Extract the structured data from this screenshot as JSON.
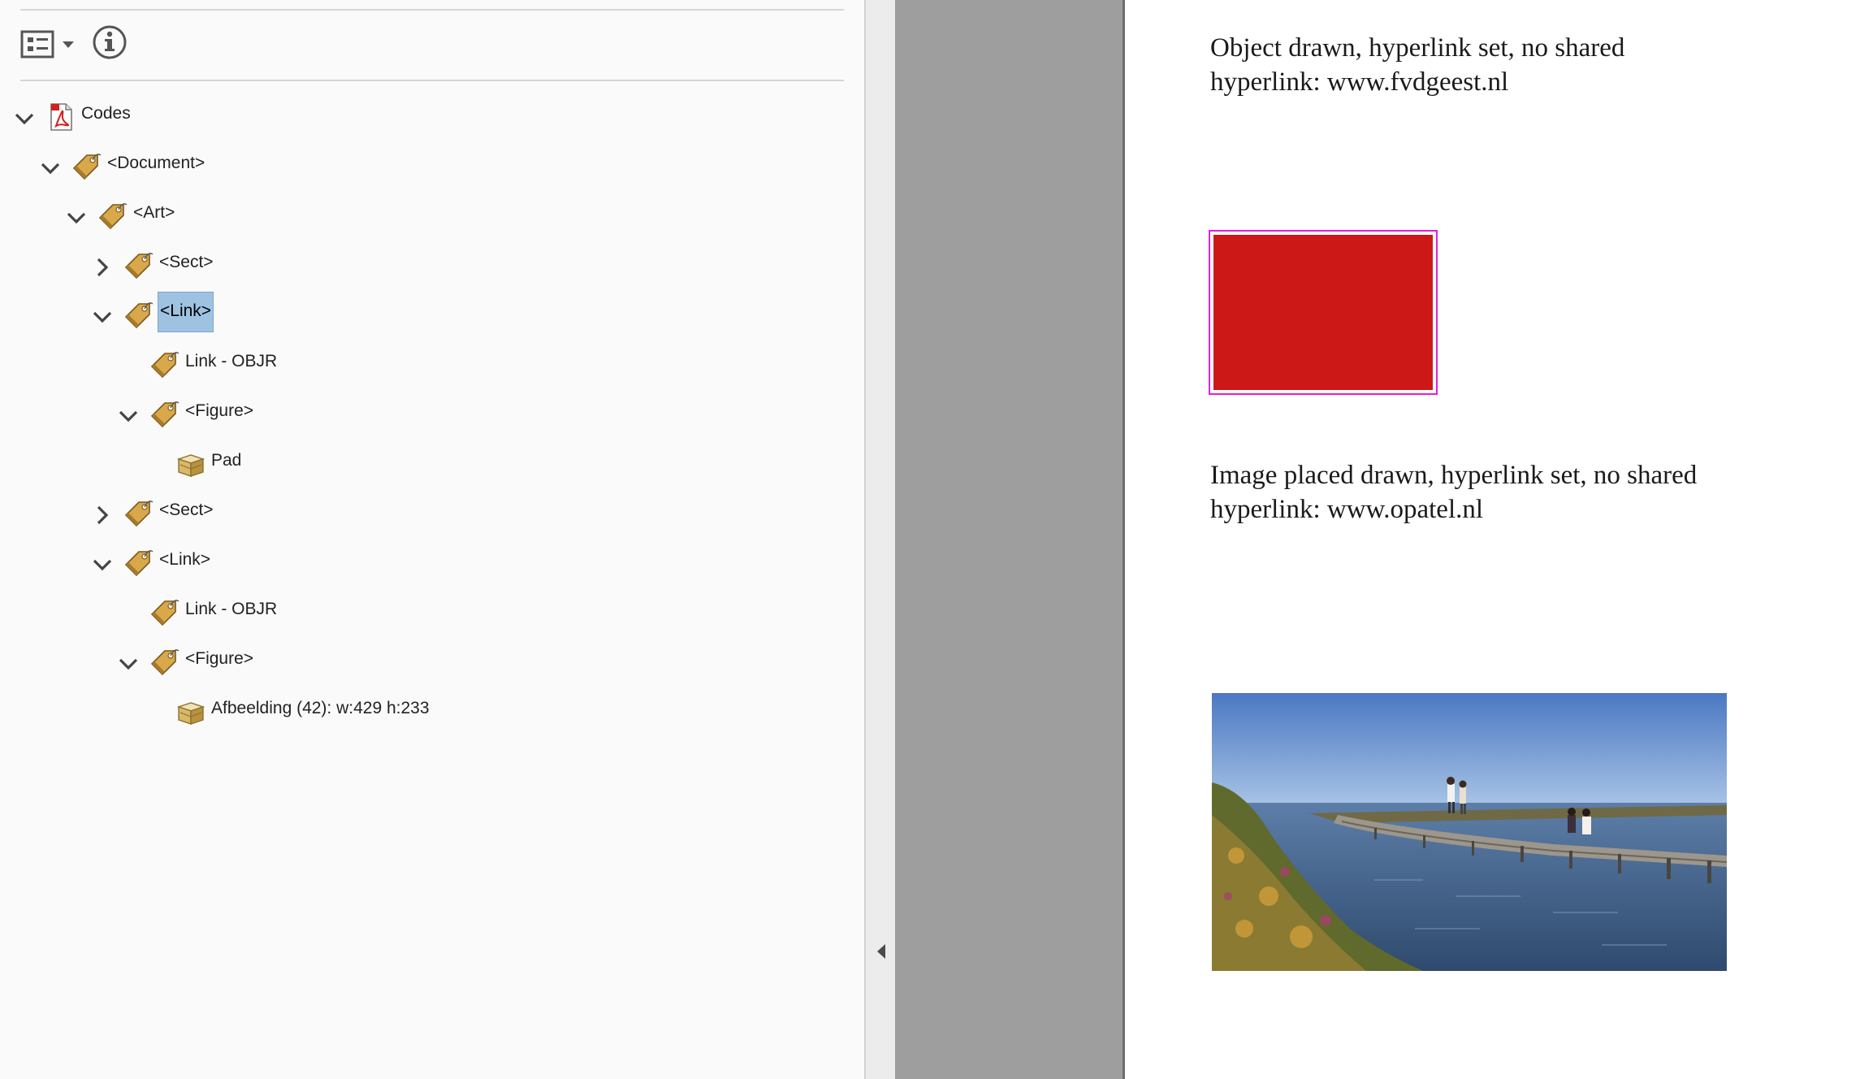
{
  "tags_panel": {
    "tree": [
      {
        "label": "Codes",
        "kind": "pdf",
        "expander": "expanded",
        "depth": 0
      },
      {
        "label": "<Document>",
        "kind": "tag",
        "expander": "expanded",
        "depth": 1
      },
      {
        "label": "<Art>",
        "kind": "tag",
        "expander": "expanded",
        "depth": 2
      },
      {
        "label": "<Sect>",
        "kind": "tag",
        "expander": "collapsed",
        "depth": 3
      },
      {
        "label": "<Link>",
        "kind": "tag",
        "expander": "expanded",
        "depth": 3,
        "selected": true
      },
      {
        "label": "Link - OBJR",
        "kind": "tag",
        "expander": "none",
        "depth": 4
      },
      {
        "label": "<Figure>",
        "kind": "tag",
        "expander": "expanded",
        "depth": 4
      },
      {
        "label": "Pad",
        "kind": "content",
        "expander": "none",
        "depth": 5
      },
      {
        "label": "<Sect>",
        "kind": "tag",
        "expander": "collapsed",
        "depth": 3
      },
      {
        "label": "<Link>",
        "kind": "tag",
        "expander": "expanded",
        "depth": 3
      },
      {
        "label": "Link - OBJR",
        "kind": "tag",
        "expander": "none",
        "depth": 4
      },
      {
        "label": "<Figure>",
        "kind": "tag",
        "expander": "expanded",
        "depth": 4
      },
      {
        "label": "Afbeelding (42): w:429 h:233",
        "kind": "content",
        "expander": "none",
        "depth": 5
      }
    ],
    "icons": {
      "options": "options-menu-icon",
      "info": "info-icon",
      "tag": "tag-icon",
      "content": "content-box-icon",
      "pdf": "pdf-file-icon"
    }
  },
  "document": {
    "paragraph_1": "Object drawn, hyperlink set, no shared hyperlink: www.fvdgeest.nl",
    "paragraph_2": "Image placed drawn, hyperlink set, no shared hyperlink: www.opatel.nl"
  },
  "colors": {
    "selection": "#9ec3e2",
    "red_box_fill": "#cd1818",
    "red_box_border": "#e11fd8",
    "tag_icon": "#d9a84a",
    "doc_gray": "#9e9e9e"
  }
}
